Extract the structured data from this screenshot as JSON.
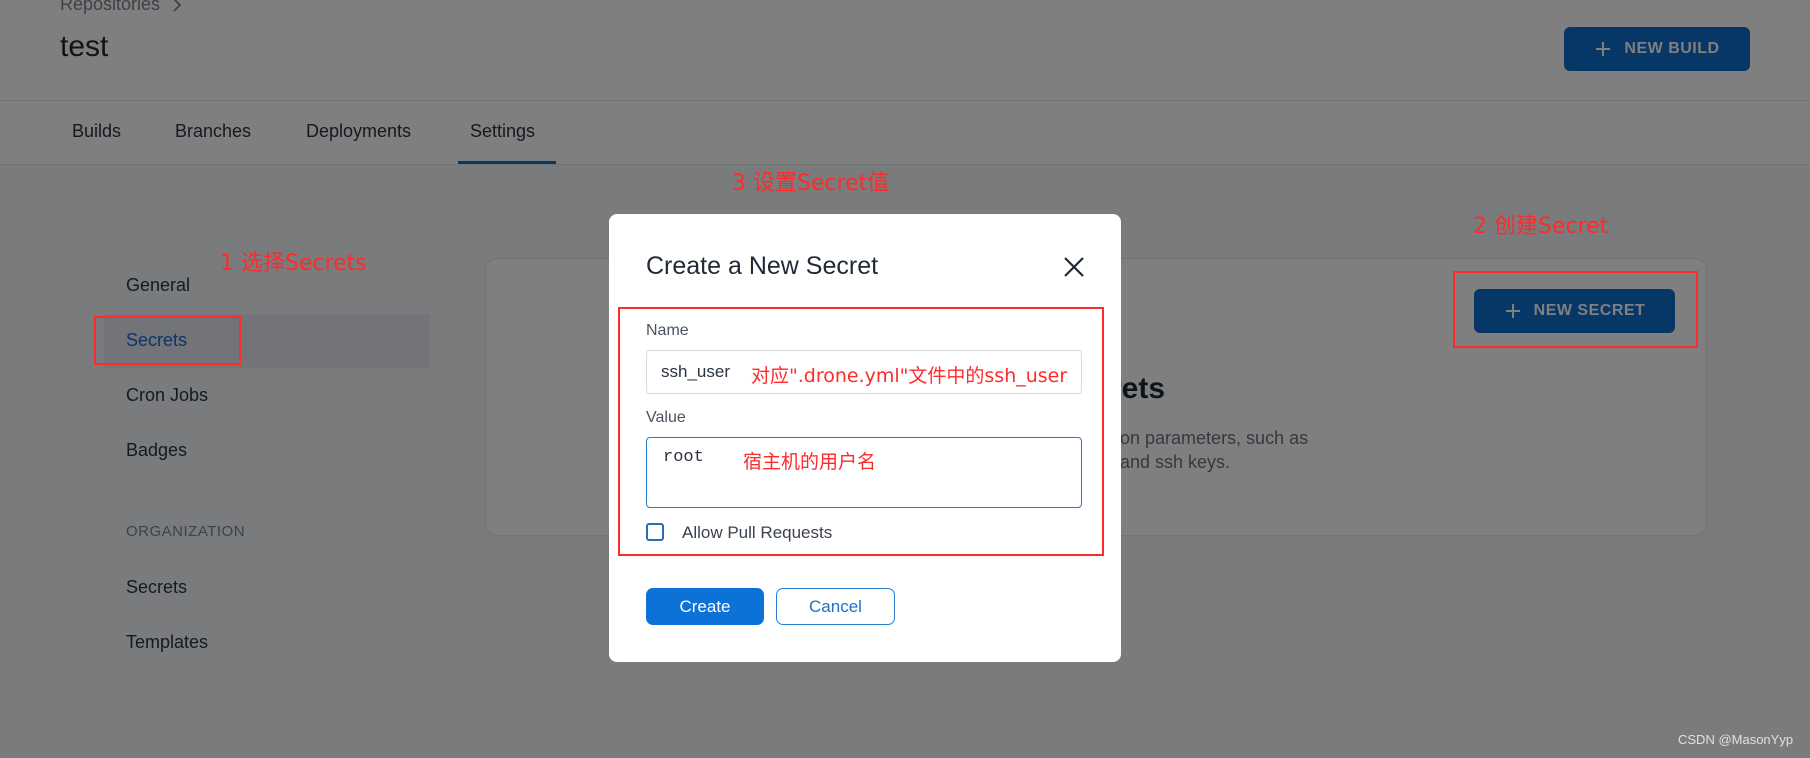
{
  "header": {
    "breadcrumb": "Repositories",
    "title": "test",
    "new_build_label": "NEW BUILD"
  },
  "tabs": [
    {
      "label": "Builds"
    },
    {
      "label": "Branches"
    },
    {
      "label": "Deployments"
    },
    {
      "label": "Settings"
    }
  ],
  "sidebar": {
    "items": [
      {
        "label": "General"
      },
      {
        "label": "Secrets"
      },
      {
        "label": "Cron Jobs"
      },
      {
        "label": "Badges"
      }
    ],
    "org_heading": "ORGANIZATION",
    "org_items": [
      {
        "label": "Secrets"
      },
      {
        "label": "Templates"
      }
    ]
  },
  "secrets_panel": {
    "new_secret_label": "NEW SECRET",
    "title_fragment": "rets",
    "desc_line1": "on parameters, such as",
    "desc_line2": "and ssh keys."
  },
  "modal": {
    "title": "Create a New Secret",
    "name_label": "Name",
    "name_value": "ssh_user",
    "value_label": "Value",
    "value_value": "root",
    "allow_pr_label": "Allow Pull Requests",
    "create_label": "Create",
    "cancel_label": "Cancel"
  },
  "annotations": {
    "step1": "1 选择Secrets",
    "step2": "2 创建Secret",
    "step3": "3 设置Secret值",
    "name_note": "对应\".drone.yml\"文件中的ssh_user",
    "value_note": "宿主机的用户名"
  },
  "watermark": "CSDN @MasonYyp",
  "colors": {
    "primary": "#0d6fcf",
    "annotation": "#ff2a2a"
  }
}
